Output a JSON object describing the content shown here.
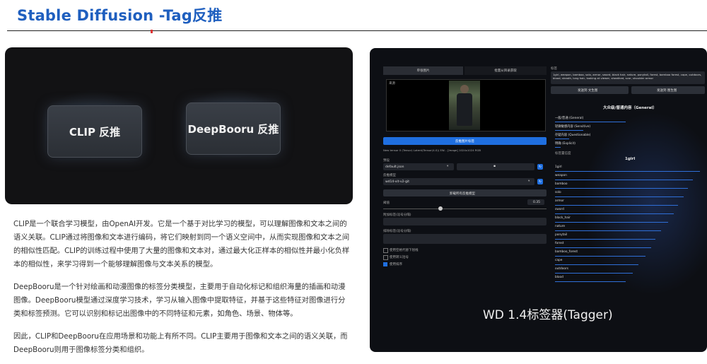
{
  "header": {
    "title": "Stable Diffusion -Tag反推"
  },
  "left_panel": {
    "buttons": [
      "CLIP 反推",
      "DeepBooru 反推"
    ]
  },
  "paragraphs": [
    "CLIP是一个联合学习模型，由OpenAI开发。它是一个基于对比学习的模型，可以理解图像和文本之间的语义关联。CLIP通过将图像和文本进行编码，将它们映射到同一个语义空间中，从而实现图像和文本之间的相似性匹配。CLIP的训练过程中使用了大量的图像和文本对，通过最大化正样本的相似性并最小化负样本的相似性，来学习得到一个能够理解图像与文本关系的模型。",
    "DeepBooru是一个针对绘画和动漫图像的标签分类模型，主要用于自动化标记和组织海量的插画和动漫图像。DeepBooru模型通过深度学习技术，学习从输入图像中提取特征，并基于这些特征对图像进行分类和标签预测。它可以识别和标记出图像中的不同特征和元素，如角色、场景、物体等。",
    "因此，CLIP和DeepBooru在应用场景和功能上有所不同。CLIP主要用于图像和文本之间的语义关联，而DeepBooru则用于图像标签分类和组织。"
  ],
  "tagger_ui": {
    "caption": "WD 1.4标签器(Tagger)",
    "tabs": [
      "单张图片",
      "批量从目录获取"
    ],
    "upload_label": "来源",
    "interrogate_button": "反推图片标签",
    "model_path_text": "New tensor 0 (Tensor) Latent(Tensor(4.0)) EW... [Image] 1024x1024 RGB",
    "preset_label": "预设",
    "preset_value": "default.json",
    "model_label": "反推模型",
    "model_value": "wd14-vit-v2-git",
    "unload_button": "卸载所有反推模型",
    "threshold_label": "阈值",
    "threshold_value": "0.35",
    "extra_label_1": "附加标签(逗号分隔)",
    "extra_label_2": "排除标签(逗号分隔)",
    "checkbox_1": "使用空格代替下划线",
    "checkbox_2": "使用转义括号",
    "checkbox_3": "使用排序",
    "tags_label": "标签",
    "tags_text": "1girl, weapon, bamboo, solo, armor, sword, black hair, nature, ponytail, forest, bamboo forest, cape, outdoors, blood, sheath, long hair, looking at viewer, sheathed, scar, shoulder armor",
    "send_to_txt2img": "发送到 文生图",
    "send_to_img2img": "发送到 图生图",
    "rating_title": "大众级/普通内容（General）",
    "ratings": [
      "一般/普通 (General)",
      "轻微敏感内容 (Sensitive)",
      "存疑内容 (Questionable)",
      "明确 (Explicit)"
    ],
    "tag_confidence_label": "标签置信度",
    "top_tag": "1girl",
    "tags": [
      "1girl",
      "weapon",
      "bamboo",
      "solo",
      "armor",
      "sword",
      "black_hair",
      "nature",
      "ponytail",
      "forest",
      "bamboo_forest",
      "cape",
      "outdoors",
      "blood"
    ]
  }
}
